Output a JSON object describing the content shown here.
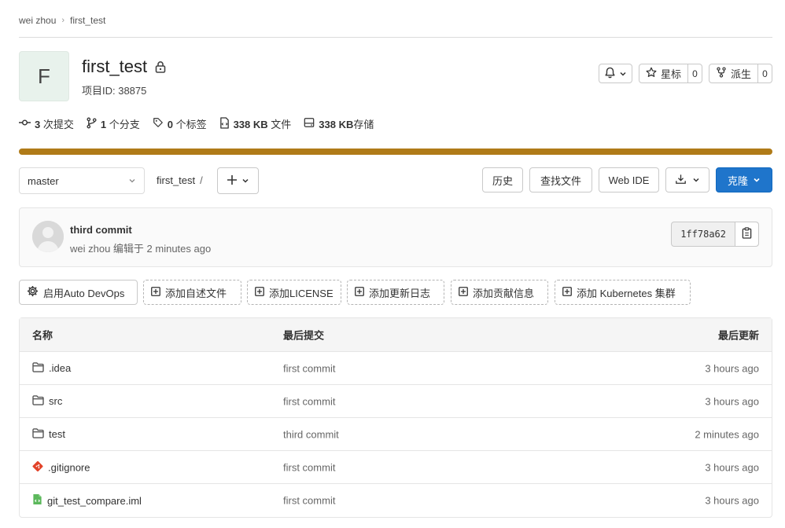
{
  "breadcrumb": {
    "owner": "wei zhou",
    "project": "first_test"
  },
  "project": {
    "avatar_letter": "F",
    "name": "first_test",
    "id_text": "项目ID: 38875"
  },
  "actions": {
    "star_label": "星标",
    "star_count": "0",
    "fork_label": "派生",
    "fork_count": "0"
  },
  "stats": [
    {
      "icon": "commit-icon",
      "value": "3",
      "label": " 次提交"
    },
    {
      "icon": "branch-icon",
      "value": "1",
      "label": " 个分支"
    },
    {
      "icon": "tag-icon",
      "value": "0",
      "label": " 个标签"
    },
    {
      "icon": "file-icon",
      "value": "338 KB",
      "label": " 文件"
    },
    {
      "icon": "storage-icon",
      "value": "338 KB",
      "label": "存储"
    }
  ],
  "language_bar_color": "#b07b18",
  "toolbar": {
    "branch": "master",
    "path": "first_test",
    "history": "历史",
    "find_file": "查找文件",
    "web_ide": "Web IDE",
    "clone": "克隆"
  },
  "commit": {
    "title": "third commit",
    "meta": "wei zhou 编辑于 2 minutes ago",
    "sha": "1ff78a62"
  },
  "quick_actions": [
    "启用Auto DevOps",
    "添加自述文件",
    "添加LICENSE",
    "添加更新日志",
    "添加贡献信息",
    "添加 Kubernetes 集群"
  ],
  "table": {
    "headers": {
      "name": "名称",
      "commit": "最后提交",
      "date": "最后更新"
    },
    "rows": [
      {
        "name": ".idea",
        "type": "folder-icon",
        "commit": "first commit",
        "date": "3 hours ago"
      },
      {
        "name": "src",
        "type": "folder-icon",
        "commit": "first commit",
        "date": "3 hours ago"
      },
      {
        "name": "test",
        "type": "folder-icon",
        "commit": "third commit",
        "date": "2 minutes ago"
      },
      {
        "name": ".gitignore",
        "type": "git-file-icon",
        "commit": "first commit",
        "date": "3 hours ago"
      },
      {
        "name": "git_test_compare.iml",
        "type": "code-file-icon",
        "commit": "first commit",
        "date": "3 hours ago"
      }
    ]
  },
  "colors": {
    "primary": "#1f75cb",
    "git_icon": "#e24329",
    "iml_icon": "#5cb85c"
  }
}
